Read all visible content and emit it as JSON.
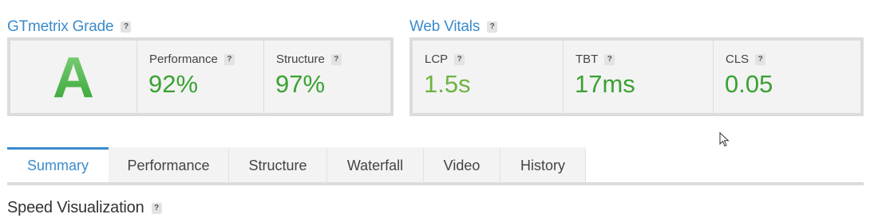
{
  "grade_section": {
    "title": "GTmetrix Grade",
    "help": "?",
    "grade": "A",
    "metrics": [
      {
        "label": "Performance",
        "value": "92%"
      },
      {
        "label": "Structure",
        "value": "97%"
      }
    ]
  },
  "vitals_section": {
    "title": "Web Vitals",
    "help": "?",
    "metrics": [
      {
        "label": "LCP",
        "value": "1.5s"
      },
      {
        "label": "TBT",
        "value": "17ms"
      },
      {
        "label": "CLS",
        "value": "0.05"
      }
    ]
  },
  "tabs": [
    {
      "label": "Summary"
    },
    {
      "label": "Performance"
    },
    {
      "label": "Structure"
    },
    {
      "label": "Waterfall"
    },
    {
      "label": "Video"
    },
    {
      "label": "History"
    }
  ],
  "active_tab": "Summary",
  "speed_section": {
    "title": "Speed Visualization",
    "help": "?"
  },
  "colors": {
    "accent": "#3b8bcc",
    "grade_green": "#35a535",
    "value_green": "#3aa233",
    "lcp_green": "#6cb442"
  }
}
